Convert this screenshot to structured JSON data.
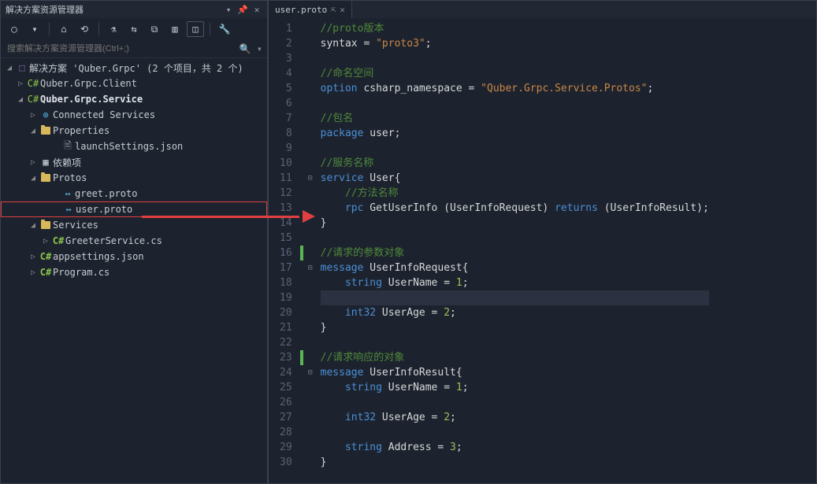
{
  "explorer": {
    "title": "解决方案资源管理器",
    "search_placeholder": "搜索解决方案资源管理器(Ctrl+;)",
    "solution_label": "解决方案 'Quber.Grpc' (2 个项目，共 2 个)",
    "nodes": {
      "client": "Quber.Grpc.Client",
      "service": "Quber.Grpc.Service",
      "connected": "Connected Services",
      "properties": "Properties",
      "launch": "launchSettings.json",
      "deps": "依赖项",
      "protos": "Protos",
      "greet": "greet.proto",
      "user": "user.proto",
      "services": "Services",
      "greeter": "GreeterService.cs",
      "appsettings": "appsettings.json",
      "program": "Program.cs"
    }
  },
  "editor": {
    "tab_title": "user.proto",
    "lines": [
      "1",
      "2",
      "3",
      "4",
      "5",
      "6",
      "7",
      "8",
      "9",
      "10",
      "11",
      "12",
      "13",
      "14",
      "15",
      "16",
      "17",
      "18",
      "19",
      "20",
      "21",
      "22",
      "23",
      "24",
      "25",
      "26",
      "27",
      "28",
      "29",
      "30"
    ],
    "code": {
      "l1c": "//proto版本",
      "l2a": "syntax = ",
      "l2b": "\"proto3\"",
      "l2c": ";",
      "l4c": "//命名空间",
      "l5a": "option",
      "l5b": " csharp_namespace = ",
      "l5c": "\"Quber.Grpc.Service.Protos\"",
      "l5d": ";",
      "l7c": "//包名",
      "l8a": "package",
      "l8b": " user;",
      "l10c": "//服务名称",
      "l11a": "service",
      "l11b": " User{",
      "l12c": "    //方法名称",
      "l13a": "    rpc",
      "l13b": " GetUserInfo (UserInfoRequest) ",
      "l13c": "returns",
      "l13d": " (UserInfoResult);",
      "l14": "}",
      "l16c": "//请求的参数对象",
      "l17a": "message",
      "l17b": " UserInfoRequest{",
      "l18a": "    string",
      "l18b": " UserName = ",
      "l18n": "1",
      "l18c": ";",
      "l19": "    ",
      "l20a": "    int32",
      "l20b": " UserAge = ",
      "l20n": "2",
      "l20c": ";",
      "l21": "}",
      "l23c": "//请求响应的对象",
      "l24a": "message",
      "l24b": " UserInfoResult{",
      "l25a": "    string",
      "l25b": " UserName = ",
      "l25n": "1",
      "l25c": ";",
      "l27a": "    int32",
      "l27b": " UserAge = ",
      "l27n": "2",
      "l27c": ";",
      "l29a": "    string",
      "l29b": " Address = ",
      "l29n": "3",
      "l29c": ";",
      "l30": "}"
    }
  }
}
